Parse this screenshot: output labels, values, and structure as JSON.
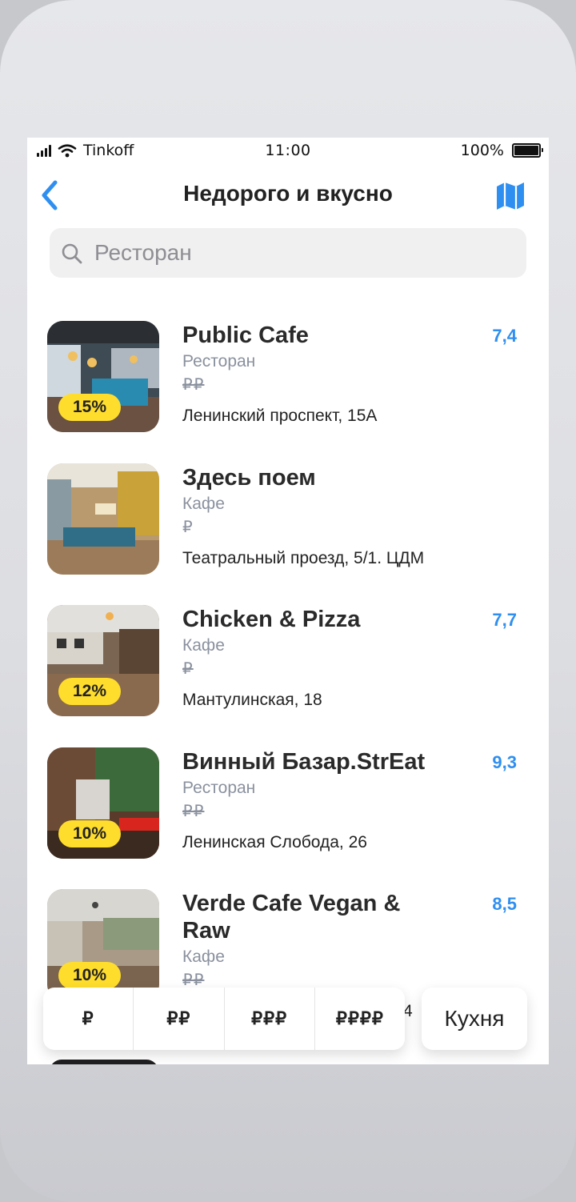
{
  "status_bar": {
    "carrier": "Tinkoff",
    "time": "11:00",
    "battery": "100%"
  },
  "nav": {
    "title": "Недорого и вкусно",
    "back_icon": "chevron-left-icon",
    "map_icon": "map-icon"
  },
  "search": {
    "placeholder": "Ресторан"
  },
  "colors": {
    "accent": "#2f8ff0",
    "badge": "#ffdd2d",
    "secondary_text": "#8a919e"
  },
  "restaurants": [
    {
      "name": "Public Cafe",
      "category": "Ресторан",
      "price": "₽₽",
      "address": "Ленинский проспект, 15А",
      "rating": "7,4",
      "discount": "15%"
    },
    {
      "name": "Здесь поем",
      "category": "Кафе",
      "price": "₽",
      "address": "Театральный проезд, 5/1. ЦДМ",
      "rating": "",
      "discount": ""
    },
    {
      "name": "Chicken & Pizza",
      "category": "Кафе",
      "price": "₽",
      "address": "Мантулинская, 18",
      "rating": "7,7",
      "discount": "12%"
    },
    {
      "name": "Винный Базар.StrEat",
      "category": "Ресторан",
      "price": "₽₽",
      "address": "Ленинская Слобода, 26",
      "rating": "9,3",
      "discount": "10%"
    },
    {
      "name": "Verde Cafe Vegan & Raw",
      "category": "Кафе",
      "price": "₽₽",
      "address": "4",
      "rating": "8,5",
      "discount": "10%"
    }
  ],
  "filters": {
    "price_levels": [
      "₽",
      "₽₽",
      "₽₽₽",
      "₽₽₽₽"
    ],
    "cuisine_label": "Кухня"
  }
}
